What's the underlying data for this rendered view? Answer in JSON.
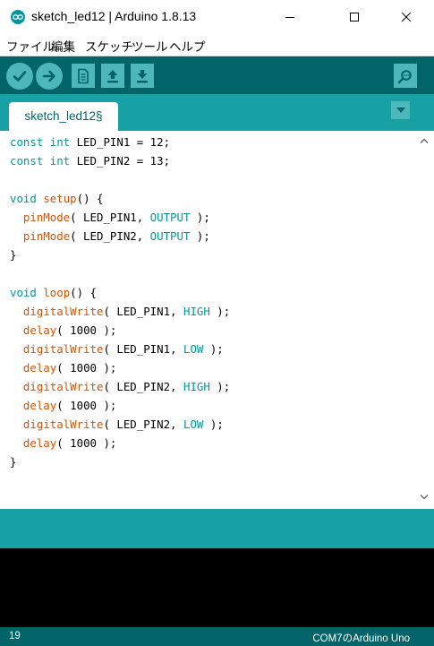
{
  "window": {
    "title": "sketch_led12 | Arduino 1.8.13",
    "icon": "arduino-logo-icon",
    "controls": [
      "minimize-icon",
      "maximize-icon",
      "close-icon"
    ]
  },
  "menu": {
    "items": [
      "ファイル",
      "編集",
      "スケッチ",
      "ツール",
      "ヘルプ"
    ]
  },
  "toolbar": {
    "buttons": [
      "verify-icon",
      "upload-icon",
      "new-icon",
      "open-icon",
      "save-icon"
    ],
    "right_button": "serial-monitor-icon"
  },
  "tabs": {
    "active_label": "sketch_led12§",
    "menu_icon": "tab-menu-arrow-icon"
  },
  "editor": {
    "lines": [
      [
        {
          "t": "const int",
          "c": "type"
        },
        {
          "t": " LED_PIN1 = 12;"
        }
      ],
      [
        {
          "t": "const int",
          "c": "type"
        },
        {
          "t": " LED_PIN2 = 13;"
        }
      ],
      [],
      [
        {
          "t": "void",
          "c": "type"
        },
        {
          "t": " "
        },
        {
          "t": "setup",
          "c": "func"
        },
        {
          "t": "() {"
        }
      ],
      [
        {
          "t": "  "
        },
        {
          "t": "pinMode",
          "c": "func"
        },
        {
          "t": "( LED_PIN1, "
        },
        {
          "t": "OUTPUT",
          "c": "const"
        },
        {
          "t": " );"
        }
      ],
      [
        {
          "t": "  "
        },
        {
          "t": "pinMode",
          "c": "func"
        },
        {
          "t": "( LED_PIN2, "
        },
        {
          "t": "OUTPUT",
          "c": "const"
        },
        {
          "t": " );"
        }
      ],
      [
        {
          "t": "}"
        }
      ],
      [],
      [
        {
          "t": "void",
          "c": "type"
        },
        {
          "t": " "
        },
        {
          "t": "loop",
          "c": "func"
        },
        {
          "t": "() {"
        }
      ],
      [
        {
          "t": "  "
        },
        {
          "t": "digitalWrite",
          "c": "func"
        },
        {
          "t": "( LED_PIN1, "
        },
        {
          "t": "HIGH",
          "c": "const"
        },
        {
          "t": " );"
        }
      ],
      [
        {
          "t": "  "
        },
        {
          "t": "delay",
          "c": "func"
        },
        {
          "t": "( 1000 );"
        }
      ],
      [
        {
          "t": "  "
        },
        {
          "t": "digitalWrite",
          "c": "func"
        },
        {
          "t": "( LED_PIN1, "
        },
        {
          "t": "LOW",
          "c": "const"
        },
        {
          "t": " );"
        }
      ],
      [
        {
          "t": "  "
        },
        {
          "t": "delay",
          "c": "func"
        },
        {
          "t": "( 1000 );"
        }
      ],
      [
        {
          "t": "  "
        },
        {
          "t": "digitalWrite",
          "c": "func"
        },
        {
          "t": "( LED_PIN2, "
        },
        {
          "t": "HIGH",
          "c": "const"
        },
        {
          "t": " );"
        }
      ],
      [
        {
          "t": "  "
        },
        {
          "t": "delay",
          "c": "func"
        },
        {
          "t": "( 1000 );"
        }
      ],
      [
        {
          "t": "  "
        },
        {
          "t": "digitalWrite",
          "c": "func"
        },
        {
          "t": "( LED_PIN2, "
        },
        {
          "t": "LOW",
          "c": "const"
        },
        {
          "t": " );"
        }
      ],
      [
        {
          "t": "  "
        },
        {
          "t": "delay",
          "c": "func"
        },
        {
          "t": "( 1000 );"
        }
      ],
      [
        {
          "t": "}"
        }
      ]
    ],
    "scroll_icons": [
      "scroll-up-icon",
      "scroll-down-icon"
    ]
  },
  "footer": {
    "line_number": "19",
    "board_port": "COM7のArduino Uno"
  },
  "colors": {
    "toolbar_bg": "#006468",
    "tabbar_bg": "#17a1a5",
    "button_bg": "#4db7bb",
    "keyword_teal": "#00979c",
    "function_orange": "#d35400",
    "console_bg": "#000000"
  }
}
